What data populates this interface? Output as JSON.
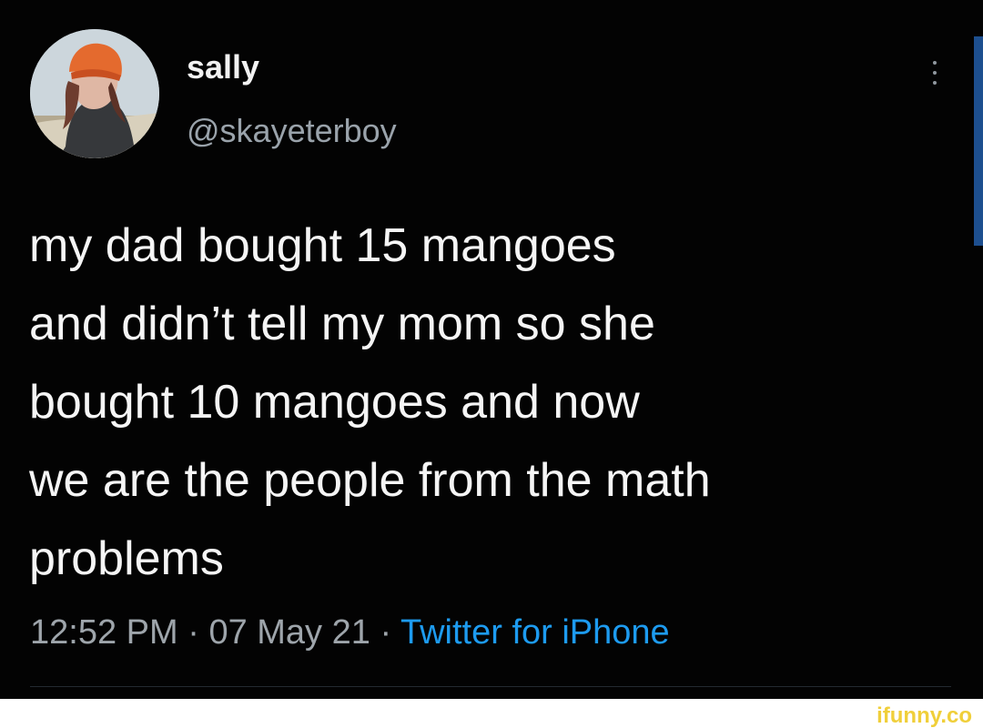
{
  "tweet": {
    "author_name": "sally",
    "author_handle": "@skayeterboy",
    "text_lines": [
      "my dad bought 15 mangoes",
      "and didn’t tell my mom so she",
      "bought 10 mangoes and now",
      "we are the people from the math",
      "problems"
    ],
    "time": "12:52 PM",
    "date": "07 May 21",
    "separator": "·",
    "source": "Twitter for iPhone",
    "more_icon": "vertical-ellipsis-icon",
    "avatar": "profile-photo"
  },
  "watermark": {
    "text": "ifunny.co"
  },
  "colors": {
    "background": "#030303",
    "primary_text": "#f5f5f5",
    "secondary_text": "#9ea5ab",
    "link": "#1d9bf0",
    "watermark": "#f0cf3a"
  }
}
